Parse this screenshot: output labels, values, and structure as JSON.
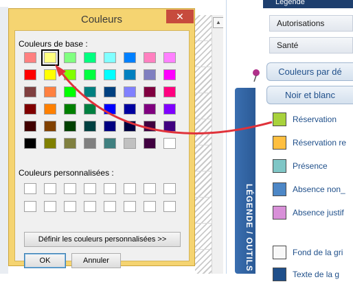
{
  "dialog": {
    "title": "Couleurs",
    "close_glyph": "✕",
    "basic_colors_label": "Couleurs de base :",
    "custom_colors_label": "Couleurs personnalisées :",
    "define_custom_label": "Définir les couleurs personnalisées >>",
    "ok_label": "OK",
    "cancel_label": "Annuler",
    "selected_color": "#ffff80",
    "basic_colors": [
      [
        "#ff8080",
        "#ffff80",
        "#80ff80",
        "#00ff80",
        "#80ffff",
        "#0080ff",
        "#ff80c0",
        "#ff80ff"
      ],
      [
        "#ff0000",
        "#ffff00",
        "#80ff00",
        "#00ff40",
        "#00ffff",
        "#0080c0",
        "#8080c0",
        "#ff00ff"
      ],
      [
        "#804040",
        "#ff8040",
        "#00ff00",
        "#008080",
        "#004080",
        "#8080ff",
        "#800040",
        "#ff0080"
      ],
      [
        "#800000",
        "#ff8000",
        "#008000",
        "#008040",
        "#0000ff",
        "#0000a0",
        "#800080",
        "#8000ff"
      ],
      [
        "#400000",
        "#804000",
        "#004000",
        "#004040",
        "#000080",
        "#000040",
        "#400040",
        "#400080"
      ],
      [
        "#000000",
        "#808000",
        "#808040",
        "#808080",
        "#408080",
        "#c0c0c0",
        "#400040",
        "#ffffff"
      ]
    ],
    "custom_colors_count": 16
  },
  "background": {
    "header_label": "Légende",
    "menu_items": [
      "Autorisations",
      "Santé"
    ],
    "buttons": [
      "Couleurs par dé",
      "Noir et blanc"
    ],
    "side_tab_label": "LÉGENDE / OUTILS",
    "legend_items": [
      {
        "label": "Réservation",
        "color": "#a8d23c"
      },
      {
        "label": "Réservation re",
        "color": "#ffbf40"
      },
      {
        "label": "Présence",
        "color": "#7fc6c6"
      },
      {
        "label": "Absence non_",
        "color": "#4d87c6"
      },
      {
        "label": "Absence justif",
        "color": "#d890d8"
      },
      {
        "label": "Fond de la gri",
        "color": "#f8f8f8"
      },
      {
        "label": "Texte de la g",
        "color": "#1f4f8a"
      }
    ]
  },
  "annotation": {
    "arrow_color": "#e0323a"
  }
}
